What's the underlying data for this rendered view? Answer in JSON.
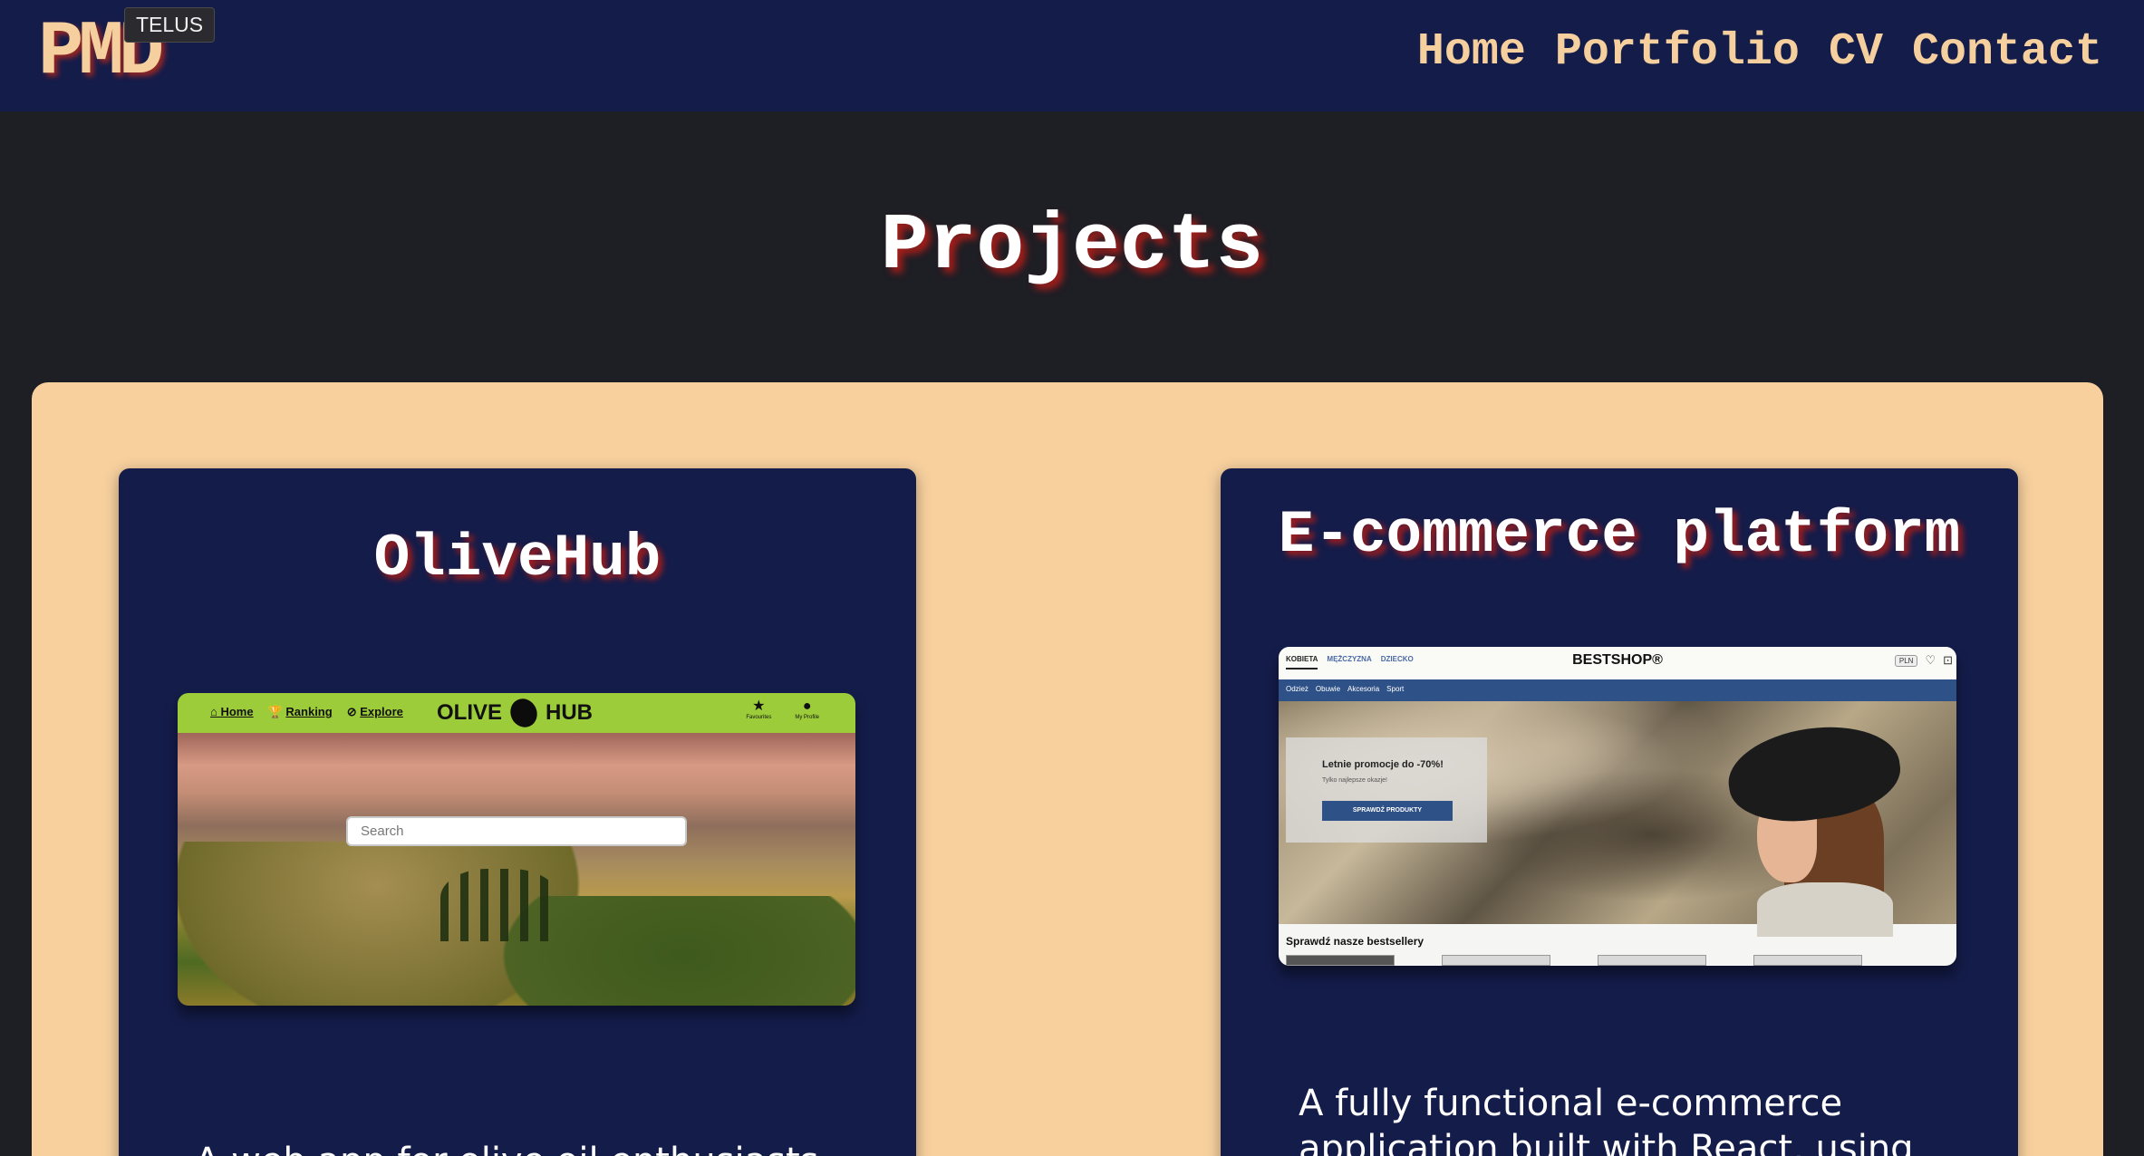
{
  "header": {
    "logo": "PMD",
    "tooltip": "TELUS",
    "nav": [
      "Home",
      "Portfolio",
      "CV",
      "Contact"
    ]
  },
  "page_title": "Projects",
  "projects": [
    {
      "title": "OliveHub",
      "description": "A web app for olive oil enthusiasts",
      "screenshot": {
        "nav_links": [
          "Home",
          "Ranking",
          "Explore"
        ],
        "logo_left": "OLIVE",
        "logo_right": "HUB",
        "icons": [
          "Favourites",
          "My Profile"
        ],
        "search_placeholder": "Search"
      }
    },
    {
      "title": "E-commerce platform",
      "description": "A fully functional e-commerce application built with React, using",
      "screenshot": {
        "tabs": [
          "KOBIETA",
          "MĘŻCZYZNA",
          "DZIECKO"
        ],
        "brand": "BESTSHOP®",
        "currency": "PLN",
        "nav": [
          "Odzież",
          "Obuwie",
          "Akcesoria",
          "Sport"
        ],
        "promo_title": "Letnie promocje do -70%!",
        "promo_sub": "Tylko najlepsze okazje!",
        "promo_button": "SPRAWDŹ PRODUKTY",
        "bestsellers": "Sprawdź nasze bestsellery"
      }
    }
  ],
  "colors": {
    "header_bg": "#141c4a",
    "page_bg": "#1e1e25",
    "panel_bg": "#f7d09e",
    "accent": "#f5cf9e",
    "title_shadow": "#aa1e19"
  },
  "icons": [
    "olive-icon",
    "star-icon",
    "user-icon",
    "heart-icon",
    "bag-icon",
    "home-icon",
    "trophy-icon",
    "compass-icon"
  ]
}
